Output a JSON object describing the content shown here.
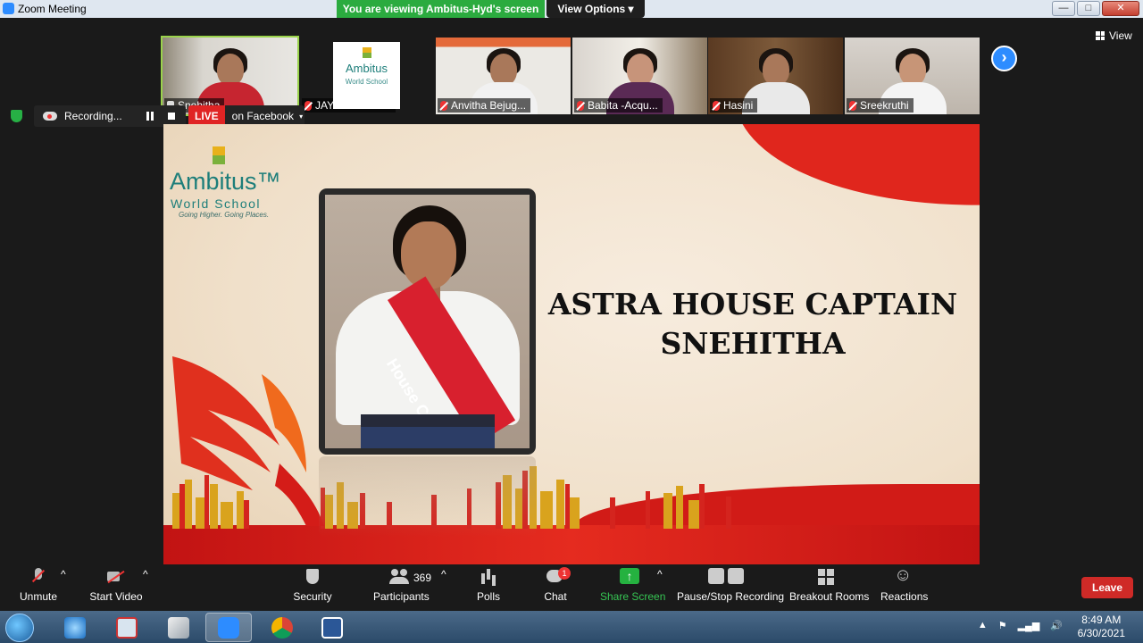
{
  "window": {
    "title": "Zoom Meeting",
    "minimize": "—",
    "maximize": "□",
    "close": "✕"
  },
  "share_banner": "You are viewing Ambitus-Hyd's screen",
  "view_options": "View Options ▾",
  "view_button": "View",
  "participants_strip": [
    {
      "name": "Snehitha"
    },
    {
      "name": "JAYASRI-MAT..."
    },
    {
      "name": "Anvitha Bejug..."
    },
    {
      "name": "Babita -Acqu..."
    },
    {
      "name": "Hasini"
    },
    {
      "name": "Sreekruthi"
    }
  ],
  "logo_tile": {
    "name": "Ambitus",
    "sub": "World School"
  },
  "recording": {
    "label": "Recording..."
  },
  "live": {
    "badge": "LIVE",
    "target": "on Facebook",
    "caret": "▾"
  },
  "slide": {
    "logo_name": "Ambitus™",
    "logo_school": "World School",
    "logo_tagline": "Going Higher. Going Places.",
    "sash_text": "House Captain",
    "caption_line1": "ASTRA HOUSE CAPTAIN",
    "caption_line2": "SNEHITHA"
  },
  "toolbar": {
    "unmute": "Unmute",
    "start_video": "Start Video",
    "security": "Security",
    "participants": "Participants",
    "participants_count": "369",
    "polls": "Polls",
    "chat": "Chat",
    "chat_badge": "1",
    "share_screen": "Share Screen",
    "pause_stop_recording": "Pause/Stop Recording",
    "breakout_rooms": "Breakout Rooms",
    "reactions": "Reactions",
    "leave": "Leave",
    "caret": "^"
  },
  "taskbar": {
    "time": "8:49 AM",
    "date": "6/30/2021"
  },
  "colors": {
    "zoom_blue": "#2d8cff",
    "share_green": "#2bab3f",
    "leave_red": "#cf2a27",
    "live_red": "#e02424",
    "brand_teal": "#1d7e7a"
  }
}
